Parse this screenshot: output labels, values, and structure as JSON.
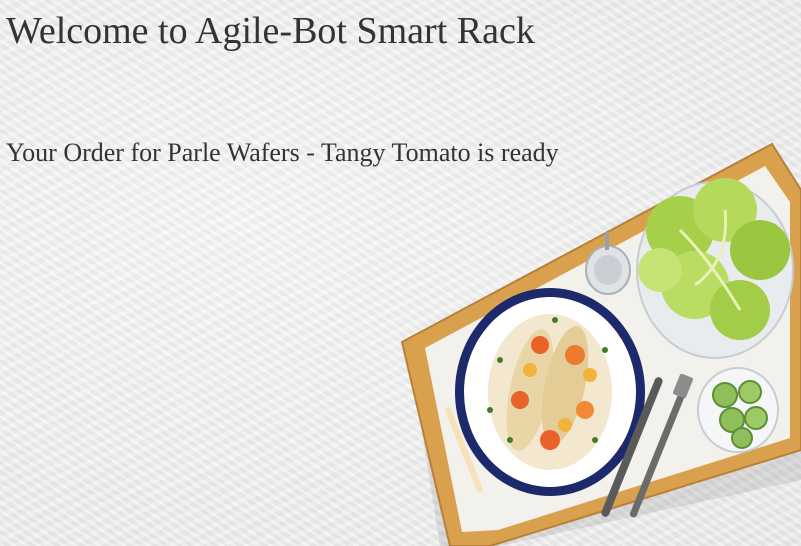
{
  "header": {
    "title": "Welcome to Agile-Bot Smart Rack"
  },
  "order": {
    "message": "Your Order for Parle Wafers - Tangy Tomato is ready"
  },
  "illustration": {
    "subject": "food-tray-image",
    "colors": {
      "tray_wood": "#d9a14e",
      "plate_rim": "#1c2a6b",
      "lettuce": "#a6cf4a",
      "cucumber": "#8fbf5a",
      "sauce": "#e8622a"
    }
  }
}
